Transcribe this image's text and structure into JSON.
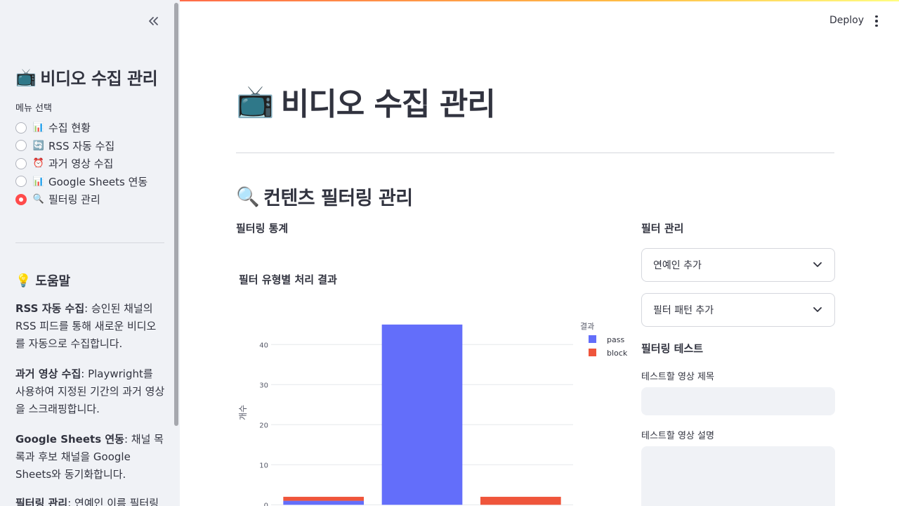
{
  "header": {
    "deploy_label": "Deploy"
  },
  "sidebar": {
    "title_emoji": "📺",
    "title": "비디오 수집 관리",
    "menu_label": "메뉴 선택",
    "items": [
      {
        "icon": "bar-chart-icon",
        "emoji": "📊",
        "label": "수집 현황",
        "selected": false
      },
      {
        "icon": "refresh-icon",
        "emoji": "🔄",
        "label": "RSS 자동 수집",
        "selected": false
      },
      {
        "icon": "alarm-clock-icon",
        "emoji": "⏰",
        "label": "과거 영상 수집",
        "selected": false
      },
      {
        "icon": "bar-chart-icon",
        "emoji": "📊",
        "label": "Google Sheets 연동",
        "selected": false
      },
      {
        "icon": "magnifier-icon",
        "emoji": "🔍",
        "label": "필터링 관리",
        "selected": true
      }
    ],
    "help_emoji": "💡",
    "help_title": "도움말",
    "help": [
      {
        "term": "RSS 자동 수집",
        "text": ": 승인된 채널의 RSS 피드를 통해 새로운 비디오를 자동으로 수집합니다."
      },
      {
        "term": "과거 영상 수집",
        "text": ": Playwright를 사용하여 지정된 기간의 과거 영상을 스크래핑합니다."
      },
      {
        "term": "Google Sheets 연동",
        "text": ": 채널 목록과 후보 채널을 Google Sheets와 동기화합니다."
      },
      {
        "term": "필터링 관리",
        "text": ": 연예인 이름 필터링과"
      }
    ]
  },
  "main": {
    "title_emoji": "📺",
    "title": "비디오 수집 관리",
    "section_emoji": "🔍",
    "section_title": "컨텐츠 필터링 관리",
    "stats_heading": "필터링 통계",
    "filter_mgmt_heading": "필터 관리",
    "expanders": [
      "연예인 추가",
      "필터 패턴 추가"
    ],
    "test_heading": "필터링 테스트",
    "test_title_label": "테스트할 영상 제목",
    "test_title_value": "",
    "test_desc_label": "테스트할 영상 설명",
    "test_desc_value": ""
  },
  "chart_data": {
    "type": "bar",
    "barmode": "stack",
    "title": "필터 유형별 처리 결과",
    "ylabel": "개수",
    "xlabel": "",
    "ylim": [
      0,
      50
    ],
    "yticks": [
      0,
      10,
      20,
      30,
      40
    ],
    "legend_title": "결과",
    "legend_position": "top-right",
    "series": [
      {
        "name": "pass",
        "color": "#636efa",
        "values": [
          1,
          45,
          0
        ]
      },
      {
        "name": "block",
        "color": "#ef553b",
        "values": [
          1,
          0,
          2
        ]
      }
    ]
  }
}
